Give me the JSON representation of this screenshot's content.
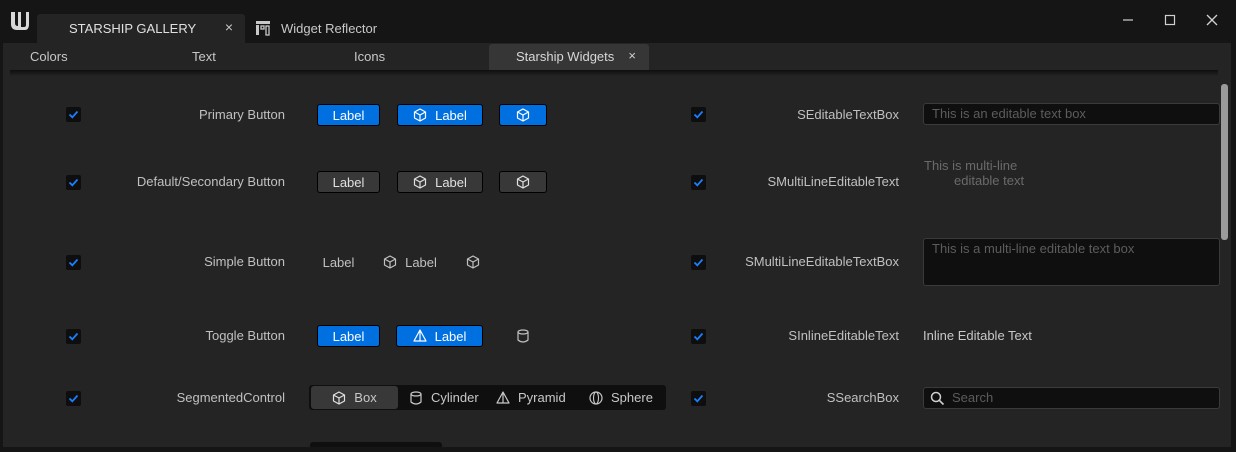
{
  "window": {
    "tab_main": "STARSHIP GALLERY",
    "tab_main_close": "×",
    "tab_reflector": "Widget Reflector"
  },
  "subtabs": [
    "Colors",
    "Text",
    "Icons",
    "Starship Widgets"
  ],
  "subtab_close": "×",
  "colors": {
    "accent": "#0070e0",
    "panel": "#242424",
    "input_bg": "#0f0f0f"
  },
  "left_rows": [
    {
      "label": "Primary Button",
      "b1": "Label",
      "b2": "Label"
    },
    {
      "label": "Default/Secondary Button",
      "b1": "Label",
      "b2": "Label"
    },
    {
      "label": "Simple Button",
      "b1": "Label",
      "b2": "Label"
    },
    {
      "label": "Toggle Button",
      "b1": "Label",
      "b2": "Label"
    },
    {
      "label": "SegmentedControl"
    }
  ],
  "segmented": {
    "options": [
      "Box",
      "Cylinder",
      "Pyramid",
      "Sphere"
    ],
    "selected": "Box"
  },
  "right_rows": [
    {
      "label": "SEditableTextBox",
      "placeholder": "This is an editable text box"
    },
    {
      "label": "SMultiLineEditableText",
      "line1": "This is multi-line",
      "line2": "editable text"
    },
    {
      "label": "SMultiLineEditableTextBox",
      "placeholder": "This is a multi-line editable text box"
    },
    {
      "label": "SInlineEditableText",
      "text": "Inline Editable Text"
    },
    {
      "label": "SSearchBox",
      "placeholder": "Search"
    }
  ],
  "icons": {
    "cube": "cube-icon",
    "pyramid": "pyramid-icon",
    "cylinder": "cylinder-icon",
    "sphere": "sphere-icon"
  }
}
